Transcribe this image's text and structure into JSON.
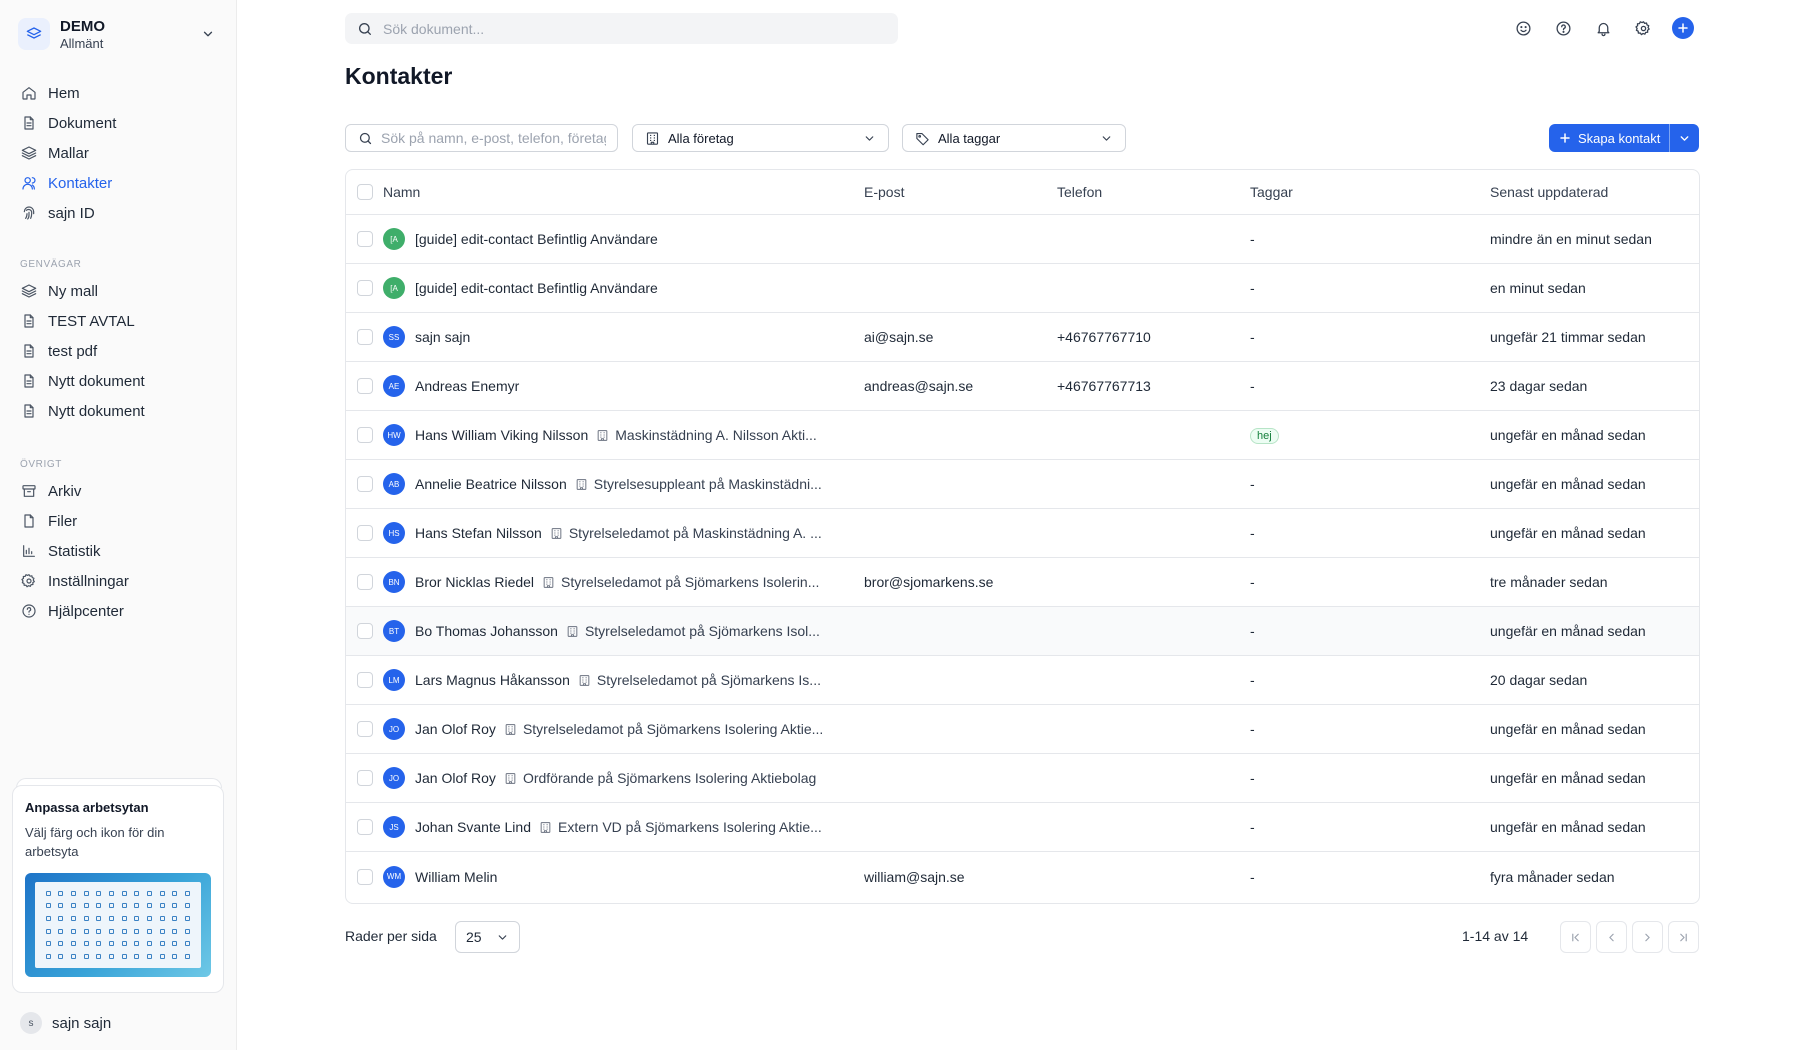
{
  "workspace": {
    "name": "DEMO",
    "subtitle": "Allmänt"
  },
  "nav": {
    "main": [
      {
        "label": "Hem",
        "icon": "home-icon"
      },
      {
        "label": "Dokument",
        "icon": "document-icon"
      },
      {
        "label": "Mallar",
        "icon": "layers-icon"
      },
      {
        "label": "Kontakter",
        "icon": "user-icon",
        "active": true
      },
      {
        "label": "sajn ID",
        "icon": "fingerprint-icon"
      }
    ],
    "shortcuts_title": "GENVÄGAR",
    "shortcuts": [
      {
        "label": "Ny mall",
        "icon": "layers-icon"
      },
      {
        "label": "TEST AVTAL",
        "icon": "document-icon"
      },
      {
        "label": "test pdf",
        "icon": "document-icon"
      },
      {
        "label": "Nytt dokument",
        "icon": "document-icon"
      },
      {
        "label": "Nytt dokument",
        "icon": "document-icon"
      }
    ],
    "other_title": "ÖVRIGT",
    "other": [
      {
        "label": "Arkiv",
        "icon": "archive-icon"
      },
      {
        "label": "Filer",
        "icon": "file-icon"
      },
      {
        "label": "Statistik",
        "icon": "chart-icon"
      },
      {
        "label": "Inställningar",
        "icon": "gear-icon"
      },
      {
        "label": "Hjälpcenter",
        "icon": "help-icon"
      }
    ]
  },
  "promo": {
    "title": "Anpassa arbetsytan",
    "text": "Välj färg och ikon för din arbetsyta"
  },
  "user": {
    "initial": "s",
    "name": "sajn sajn"
  },
  "topbar": {
    "search_placeholder": "Sök dokument..."
  },
  "page": {
    "title": "Kontakter"
  },
  "filters": {
    "search_placeholder": "Sök på namn, e-post, telefon, företag...",
    "company": "Alla företag",
    "tags": "Alla taggar",
    "create_label": "Skapa kontakt"
  },
  "table": {
    "headers": {
      "name": "Namn",
      "email": "E-post",
      "phone": "Telefon",
      "tags": "Taggar",
      "updated": "Senast uppdaterad"
    },
    "rows": [
      {
        "initials": "[A",
        "name": "[guide] edit-contact Befintlig Användare",
        "company": "",
        "email": "",
        "phone": "",
        "tags": "-",
        "updated": "mindre än en minut sedan",
        "avatar_color": "green"
      },
      {
        "initials": "[A",
        "name": "[guide] edit-contact Befintlig Användare",
        "company": "",
        "email": "",
        "phone": "",
        "tags": "-",
        "updated": "en minut sedan",
        "avatar_color": "green"
      },
      {
        "initials": "SS",
        "name": "sajn sajn",
        "company": "",
        "email": "ai@sajn.se",
        "phone": "+46767767710",
        "tags": "-",
        "updated": "ungefär 21 timmar sedan"
      },
      {
        "initials": "AE",
        "name": "Andreas Enemyr",
        "company": "",
        "email": "andreas@sajn.se",
        "phone": "+46767767713",
        "tags": "-",
        "updated": "23 dagar sedan"
      },
      {
        "initials": "HW",
        "name": "Hans William Viking Nilsson",
        "company": "Maskinstädning A. Nilsson Akti...",
        "email": "",
        "phone": "",
        "tags": "hej",
        "tag_chip": true,
        "updated": "ungefär en månad sedan"
      },
      {
        "initials": "AB",
        "name": "Annelie Beatrice Nilsson",
        "company": "Styrelsesuppleant på Maskinstädni...",
        "email": "",
        "phone": "",
        "tags": "-",
        "updated": "ungefär en månad sedan"
      },
      {
        "initials": "HS",
        "name": "Hans Stefan Nilsson",
        "company": "Styrelseledamot på Maskinstädning A. ...",
        "email": "",
        "phone": "",
        "tags": "-",
        "updated": "ungefär en månad sedan"
      },
      {
        "initials": "BN",
        "name": "Bror Nicklas Riedel",
        "company": "Styrelseledamot på Sjömarkens Isolerin...",
        "email": "bror@sjomarkens.se",
        "phone": "",
        "tags": "-",
        "updated": "tre månader sedan"
      },
      {
        "initials": "BT",
        "name": "Bo Thomas Johansson",
        "company": "Styrelseledamot på Sjömarkens Isol...",
        "email": "",
        "phone": "",
        "tags": "-",
        "updated": "ungefär en månad sedan",
        "hover": true
      },
      {
        "initials": "LM",
        "name": "Lars Magnus Håkansson",
        "company": "Styrelseledamot på Sjömarkens Is...",
        "email": "",
        "phone": "",
        "tags": "-",
        "updated": "20 dagar sedan"
      },
      {
        "initials": "JO",
        "name": "Jan Olof Roy",
        "company": "Styrelseledamot på Sjömarkens Isolering Aktie...",
        "email": "",
        "phone": "",
        "tags": "-",
        "updated": "ungefär en månad sedan"
      },
      {
        "initials": "JO",
        "name": "Jan Olof Roy",
        "company": "Ordförande på Sjömarkens Isolering Aktiebolag",
        "email": "",
        "phone": "",
        "tags": "-",
        "updated": "ungefär en månad sedan"
      },
      {
        "initials": "JS",
        "name": "Johan Svante Lind",
        "company": "Extern VD på Sjömarkens Isolering Aktie...",
        "email": "",
        "phone": "",
        "tags": "-",
        "updated": "ungefär en månad sedan"
      },
      {
        "initials": "WM",
        "name": "William Melin",
        "company": "",
        "email": "william@sajn.se",
        "phone": "",
        "tags": "-",
        "updated": "fyra månader sedan"
      }
    ]
  },
  "pagination": {
    "rows_label": "Rader per sida",
    "rows_value": "25",
    "info": "1-14 av 14"
  },
  "colors": {
    "accent": "#2563eb",
    "avatar_green": "#3fae6a",
    "tag_green": "#15803d"
  }
}
